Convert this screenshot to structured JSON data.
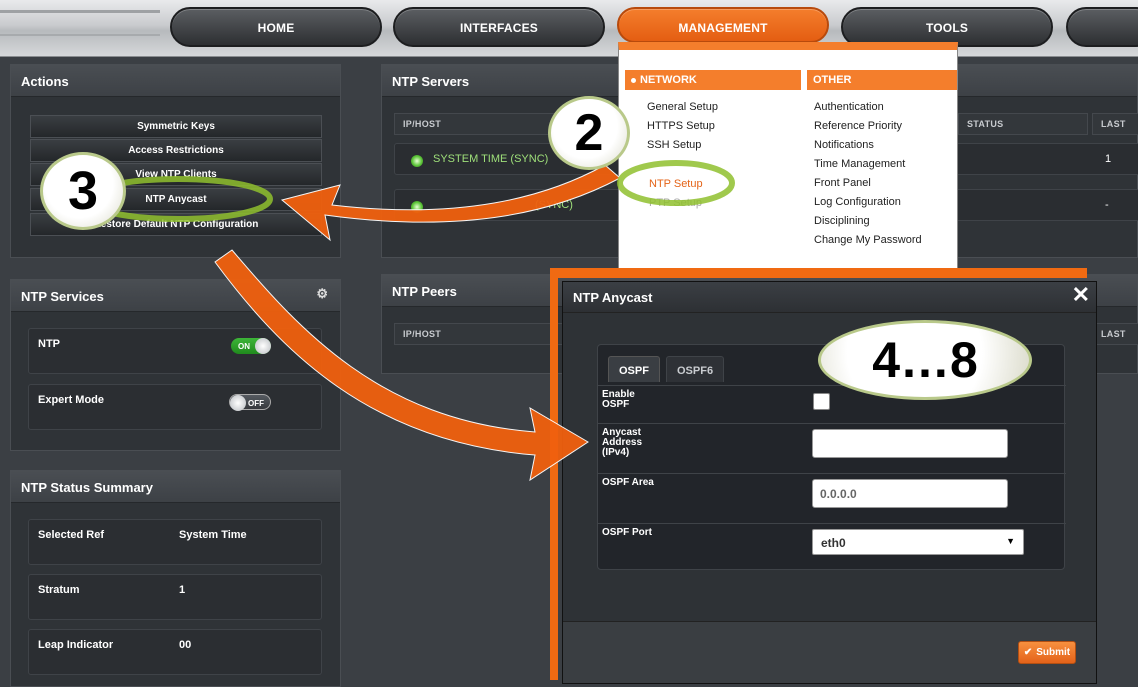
{
  "nav": {
    "tabs": [
      {
        "label": "HOME"
      },
      {
        "label": "INTERFACES"
      },
      {
        "label": "MANAGEMENT"
      },
      {
        "label": "TOOLS"
      }
    ]
  },
  "actions": {
    "title": "Actions",
    "buttons": [
      {
        "label": "Symmetric Keys"
      },
      {
        "label": "Access Restrictions"
      },
      {
        "label": "View NTP Clients"
      },
      {
        "label": "NTP Anycast"
      },
      {
        "label": "Restore Default NTP Configuration"
      }
    ]
  },
  "ntp_services": {
    "title": "NTP Services",
    "rows": [
      {
        "label": "NTP",
        "state": "ON"
      },
      {
        "label": "Expert Mode",
        "state": "OFF"
      }
    ]
  },
  "status_summary": {
    "title": "NTP Status Summary",
    "rows": [
      {
        "key": "Selected Ref",
        "value": "System Time"
      },
      {
        "key": "Stratum",
        "value": "1"
      },
      {
        "key": "Leap Indicator",
        "value": "00"
      }
    ]
  },
  "ntp_servers": {
    "title": "NTP Servers",
    "columns": {
      "host": "IP/HOST",
      "status": "STATUS",
      "last": "LAST"
    },
    "rows": [
      {
        "host": "SYSTEM TIME (SYNC)",
        "last": "1"
      },
      {
        "host": "(SYNC)",
        "last": "-"
      }
    ]
  },
  "ntp_peers": {
    "title": "NTP Peers",
    "columns": {
      "host": "IP/HOST",
      "last": "LAST"
    }
  },
  "dropdown": {
    "network_head": "NETWORK",
    "other_head": "OTHER",
    "network_items": [
      "General Setup",
      "HTTPS Setup",
      "SSH Setup",
      "NTP Setup",
      "PTP Setup"
    ],
    "other_items": [
      "Authentication",
      "Reference Priority",
      "Notifications",
      "Time Management",
      "Front Panel",
      "Log Configuration",
      "Disciplining",
      "Change My Password"
    ]
  },
  "modal": {
    "title": "NTP Anycast",
    "close": "✕",
    "tabs": [
      "OSPF",
      "OSPF6"
    ],
    "fields": {
      "enable_label": "Enable OSPF",
      "anycast_label": "Anycast Address (IPv4)",
      "anycast_value": "",
      "area_label": "OSPF Area",
      "area_value": "0.0.0.0",
      "port_label": "OSPF Port",
      "port_value": "eth0"
    },
    "submit": "Submit"
  },
  "annotations": {
    "step2": "2",
    "step3": "3",
    "step4_8": "4…8"
  },
  "colors": {
    "accent": "#f47e2c",
    "on_green": "#3db538",
    "sync_text": "#9fe07a"
  }
}
